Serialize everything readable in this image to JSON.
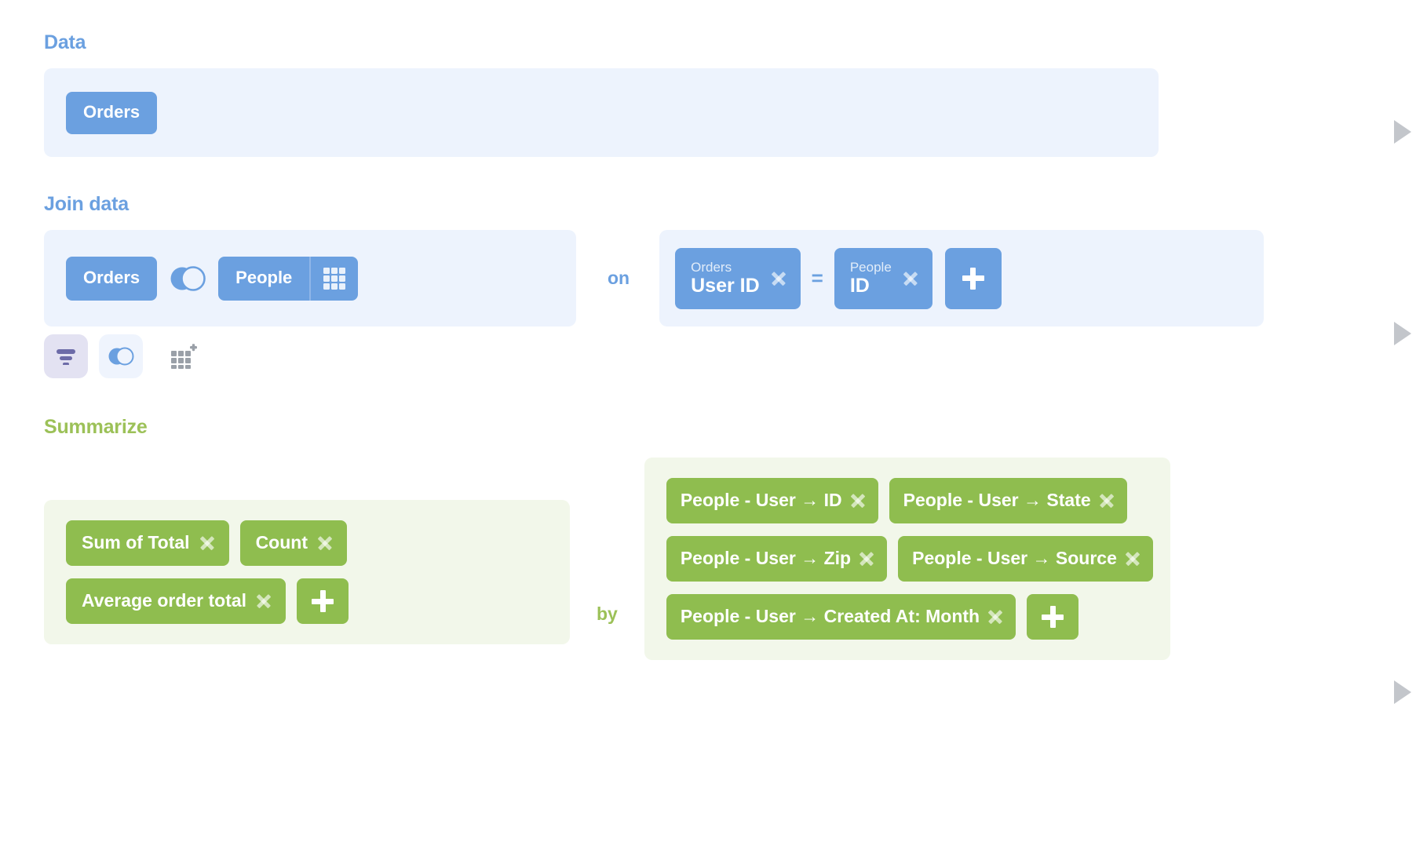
{
  "sections": {
    "data": {
      "title": "Data",
      "source_table": "Orders",
      "preview_icon": "play-triangle-icon"
    },
    "join": {
      "title": "Join data",
      "left_table": "Orders",
      "right_table": "People",
      "join_type_icon": "venn-left-join-icon",
      "fields_picker_icon": "grid-icon",
      "on_label": "on",
      "equals_label": "=",
      "conditions": [
        {
          "lhs_table": "Orders",
          "lhs_field": "User ID",
          "rhs_table": "People",
          "rhs_field": "ID"
        }
      ],
      "add_condition_label": "+",
      "actions": [
        {
          "name": "filter",
          "icon": "filter-icon",
          "active": true
        },
        {
          "name": "join",
          "icon": "venn-join-icon",
          "active": true
        },
        {
          "name": "pick-columns",
          "icon": "grid-plus-icon",
          "active": false
        }
      ],
      "preview_icon": "play-triangle-icon"
    },
    "summarize": {
      "title": "Summarize",
      "by_label": "by",
      "aggregations": [
        "Sum of Total",
        "Count",
        "Average order total"
      ],
      "add_aggregation_label": "+",
      "breakouts": [
        "People - User → ID",
        "People - User → State",
        "People - User → Zip",
        "People - User → Source",
        "People - User → Created At: Month"
      ],
      "add_breakout_label": "+",
      "preview_icon": "play-triangle-icon"
    }
  },
  "colors": {
    "data_accent": "#6ba0e0",
    "join_accent": "#6ba0e0",
    "summarize_accent": "#8fbd4f",
    "data_panel_bg": "#edf3fd",
    "summarize_panel_bg": "#f2f7ea",
    "filter_chip_bg": "#e3e2f2",
    "preview_arrow": "#c3c6cb"
  }
}
